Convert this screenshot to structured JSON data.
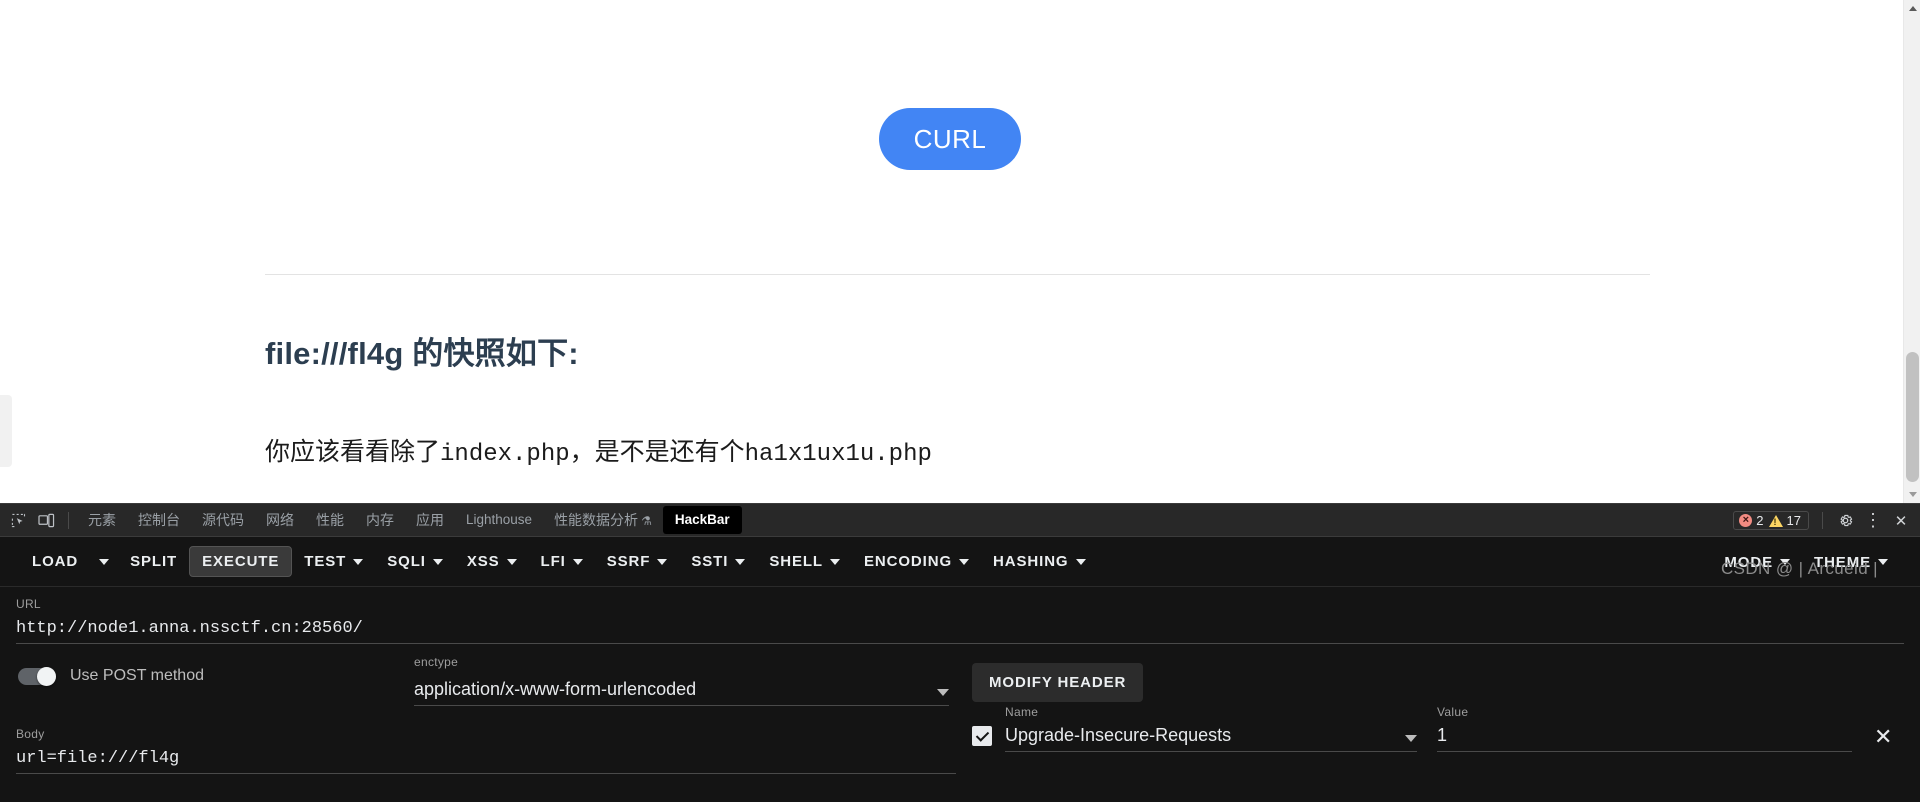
{
  "page": {
    "curl_button": "CURL",
    "snapshot_title": "file:///fl4g 的快照如下:",
    "snapshot_text_prefix": "你应该看看除了",
    "snapshot_text_mono1": "index.php",
    "snapshot_text_middle": "，是不是还有个",
    "snapshot_text_mono2": "ha1x1ux1u.php",
    "accent_color": "#4285f4"
  },
  "devtools": {
    "tabs": [
      {
        "label": "元素",
        "active": false
      },
      {
        "label": "控制台",
        "active": false
      },
      {
        "label": "源代码",
        "active": false
      },
      {
        "label": "网络",
        "active": false
      },
      {
        "label": "性能",
        "active": false
      },
      {
        "label": "内存",
        "active": false
      },
      {
        "label": "应用",
        "active": false
      },
      {
        "label": "Lighthouse",
        "active": false
      },
      {
        "label": "性能数据分析",
        "active": false
      },
      {
        "label": "HackBar",
        "active": true
      }
    ],
    "beta_glyph": "⚗",
    "errors_count": "2",
    "warnings_count": "17",
    "error_glyph": "×",
    "settings_glyph": "⚙",
    "more_glyph": "⋮",
    "close_glyph": "✕"
  },
  "hackbar": {
    "toolbar_left": [
      {
        "label": "LOAD",
        "caret": false,
        "active": false
      },
      {
        "label": "",
        "caret": true,
        "active": false
      },
      {
        "label": "SPLIT",
        "caret": false,
        "active": false
      },
      {
        "label": "EXECUTE",
        "caret": false,
        "active": true
      },
      {
        "label": "TEST",
        "caret": true,
        "active": false
      },
      {
        "label": "SQLI",
        "caret": true,
        "active": false
      },
      {
        "label": "XSS",
        "caret": true,
        "active": false
      },
      {
        "label": "LFI",
        "caret": true,
        "active": false
      },
      {
        "label": "SSRF",
        "caret": true,
        "active": false
      },
      {
        "label": "SSTI",
        "caret": true,
        "active": false
      },
      {
        "label": "SHELL",
        "caret": true,
        "active": false
      },
      {
        "label": "ENCODING",
        "caret": true,
        "active": false
      },
      {
        "label": "HASHING",
        "caret": true,
        "active": false
      }
    ],
    "toolbar_right": [
      {
        "label": "MODE",
        "caret": true
      },
      {
        "label": "THEME",
        "caret": true
      }
    ],
    "url_label": "URL",
    "url_value": "http://node1.anna.nssctf.cn:28560/",
    "post_toggle_label": "Use POST method",
    "post_toggle_on": true,
    "enctype_label": "enctype",
    "enctype_value": "application/x-www-form-urlencoded",
    "modify_header_label": "MODIFY HEADER",
    "header_name_label": "Name",
    "header_value_label": "Value",
    "header_name": "Upgrade-Insecure-Requests",
    "header_value": "1",
    "header_remove_glyph": "✕",
    "body_label": "Body",
    "body_value": "url=file:///fl4g"
  },
  "watermark": "CSDN @ | Arcueid |"
}
